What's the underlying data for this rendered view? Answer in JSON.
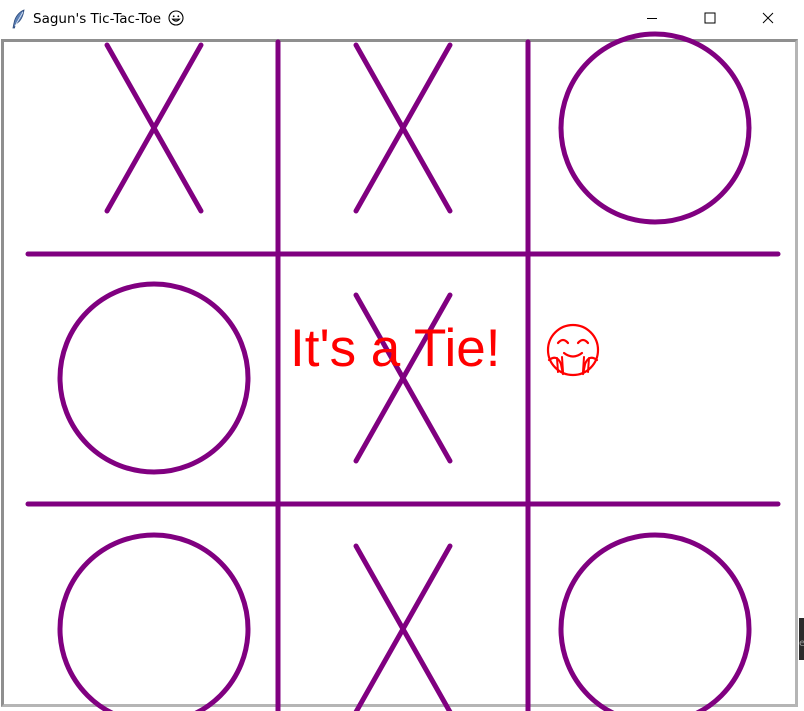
{
  "window": {
    "title": "Sagun's Tic-Tac-Toe",
    "title_icon": "feather-icon",
    "title_emoji": "smiley-face-icon",
    "controls": {
      "minimize": "minimize-icon",
      "maximize": "maximize-icon",
      "close": "close-icon"
    }
  },
  "game": {
    "status_message": "It's a Tie!",
    "status_emoji": "hugging-face-icon",
    "board": [
      [
        "X",
        "X",
        "O"
      ],
      [
        "O",
        "X",
        ""
      ],
      [
        "O",
        "X",
        "O"
      ]
    ]
  },
  "colors": {
    "grid_and_marks": "#800080",
    "status_text": "#ff0000",
    "background": "#ffffff"
  }
}
